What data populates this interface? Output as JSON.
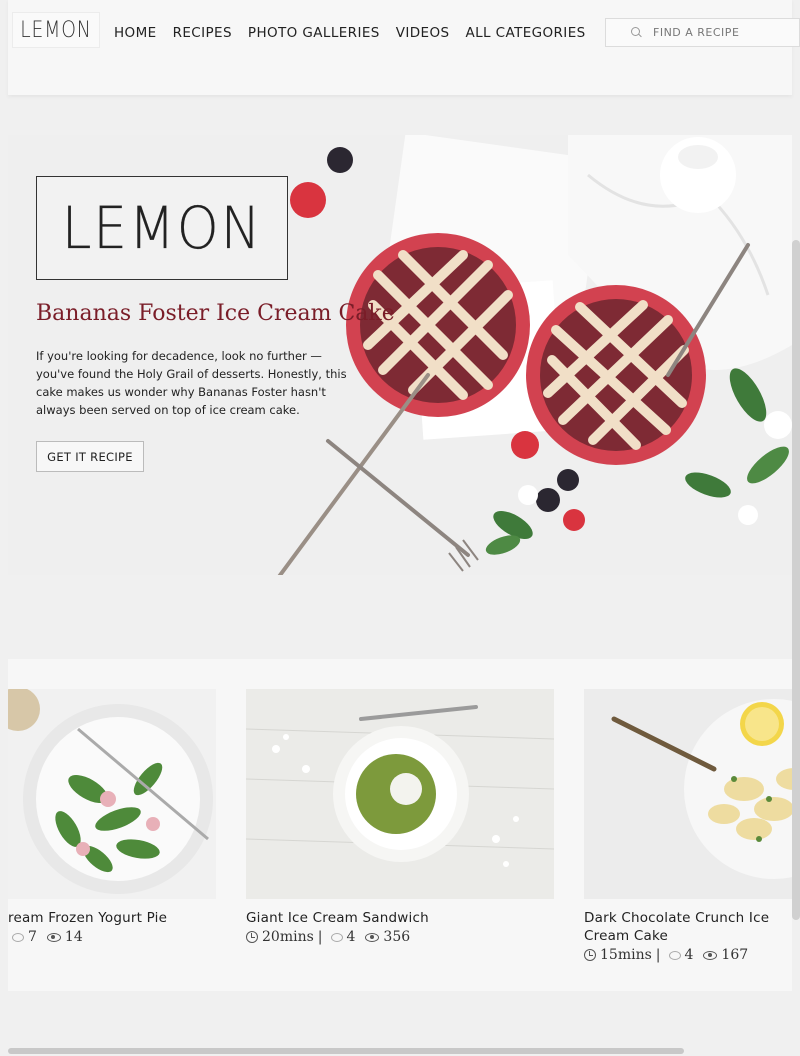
{
  "header": {
    "logo_text": "LEMON",
    "nav": [
      "HOME",
      "RECIPES",
      "PHOTO GALLERIES",
      "VIDEOS",
      "ALL CATEGORIES"
    ],
    "search_placeholder": "FIND A RECIPE"
  },
  "hero": {
    "logo_text": "LEMON",
    "title": "Bananas Foster Ice Cream Cake",
    "description": "If you're looking for decadence, look no further — you've found the Holy Grail of desserts. Honestly, this cake makes us wonder why Bananas Foster hasn't always been served on top of ice cream cake.",
    "button_label": "GET IT RECIPE"
  },
  "recipes": [
    {
      "name": "ream Frozen Yogurt Pie",
      "time": "",
      "comments": "7",
      "views": "14"
    },
    {
      "name": "Giant Ice Cream Sandwich",
      "time": "20mins",
      "comments": "4",
      "views": "356"
    },
    {
      "name": "Dark Chocolate Crunch Ice Cream Cake",
      "time": "15mins",
      "comments": "4",
      "views": "167"
    }
  ],
  "colors": {
    "accent": "#7a1d28",
    "pie_red": "#c3313b"
  }
}
